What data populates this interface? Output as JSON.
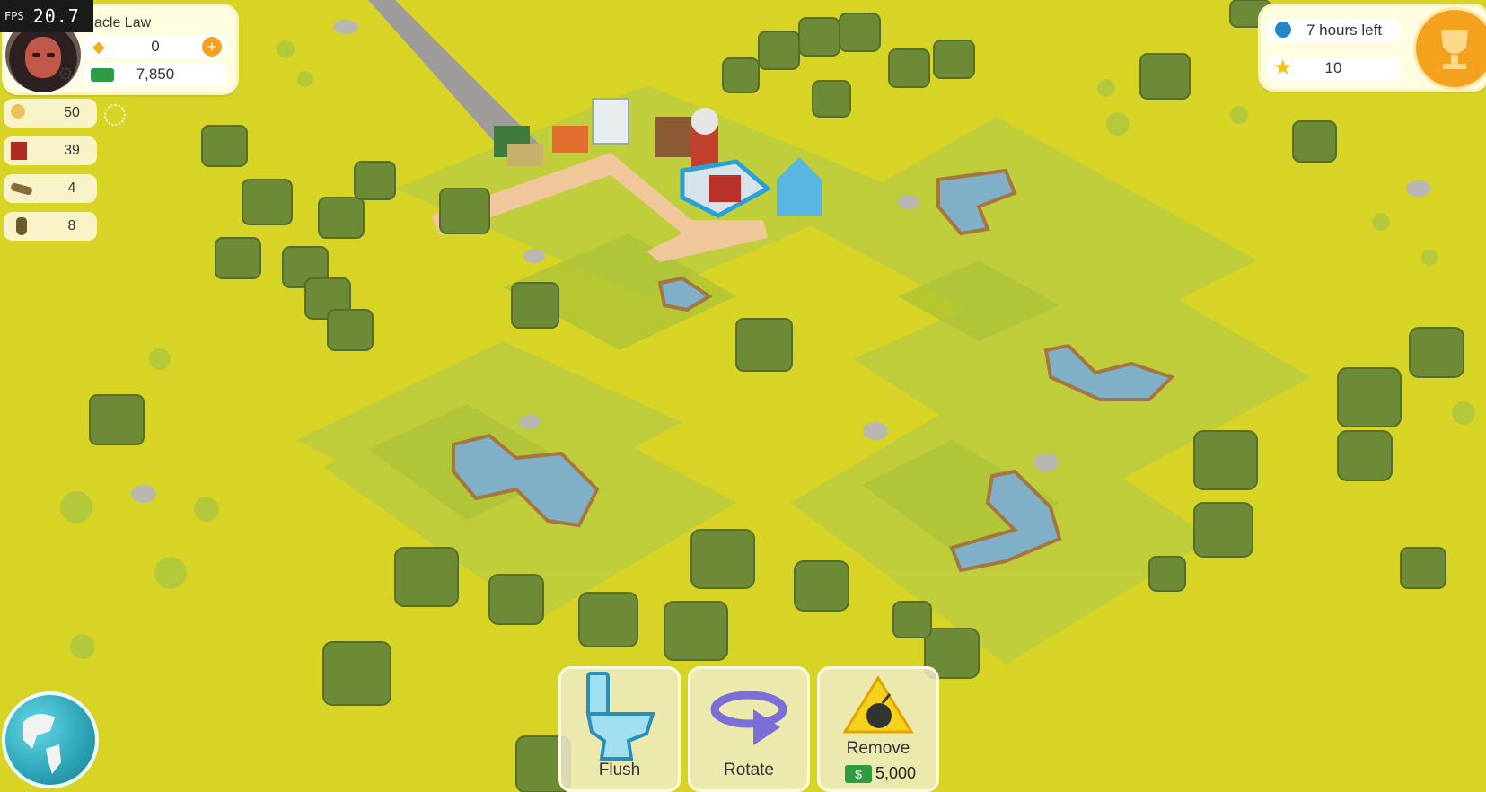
{
  "fps": {
    "label": "FPS",
    "value": "20.7"
  },
  "player": {
    "name": "acle Law",
    "gems": "0",
    "cash": "7,850"
  },
  "resources": [
    {
      "icon": "worker-icon",
      "count": "50"
    },
    {
      "icon": "brick-icon",
      "count": "39"
    },
    {
      "icon": "wood-log-icon",
      "count": "4"
    },
    {
      "icon": "acorn-icon",
      "count": "8"
    }
  ],
  "event": {
    "time_left": "7 hours left",
    "stars": "10"
  },
  "tools": {
    "flush": {
      "label": "Flush"
    },
    "rotate": {
      "label": "Rotate"
    },
    "remove": {
      "label": "Remove",
      "price": "5,000"
    }
  },
  "colors": {
    "ground": "#d8d426",
    "grass_tile": "#bfcf3a",
    "tree": "#6f8a3a",
    "water": "#7fb0c8",
    "accent": "#f4a21e"
  }
}
